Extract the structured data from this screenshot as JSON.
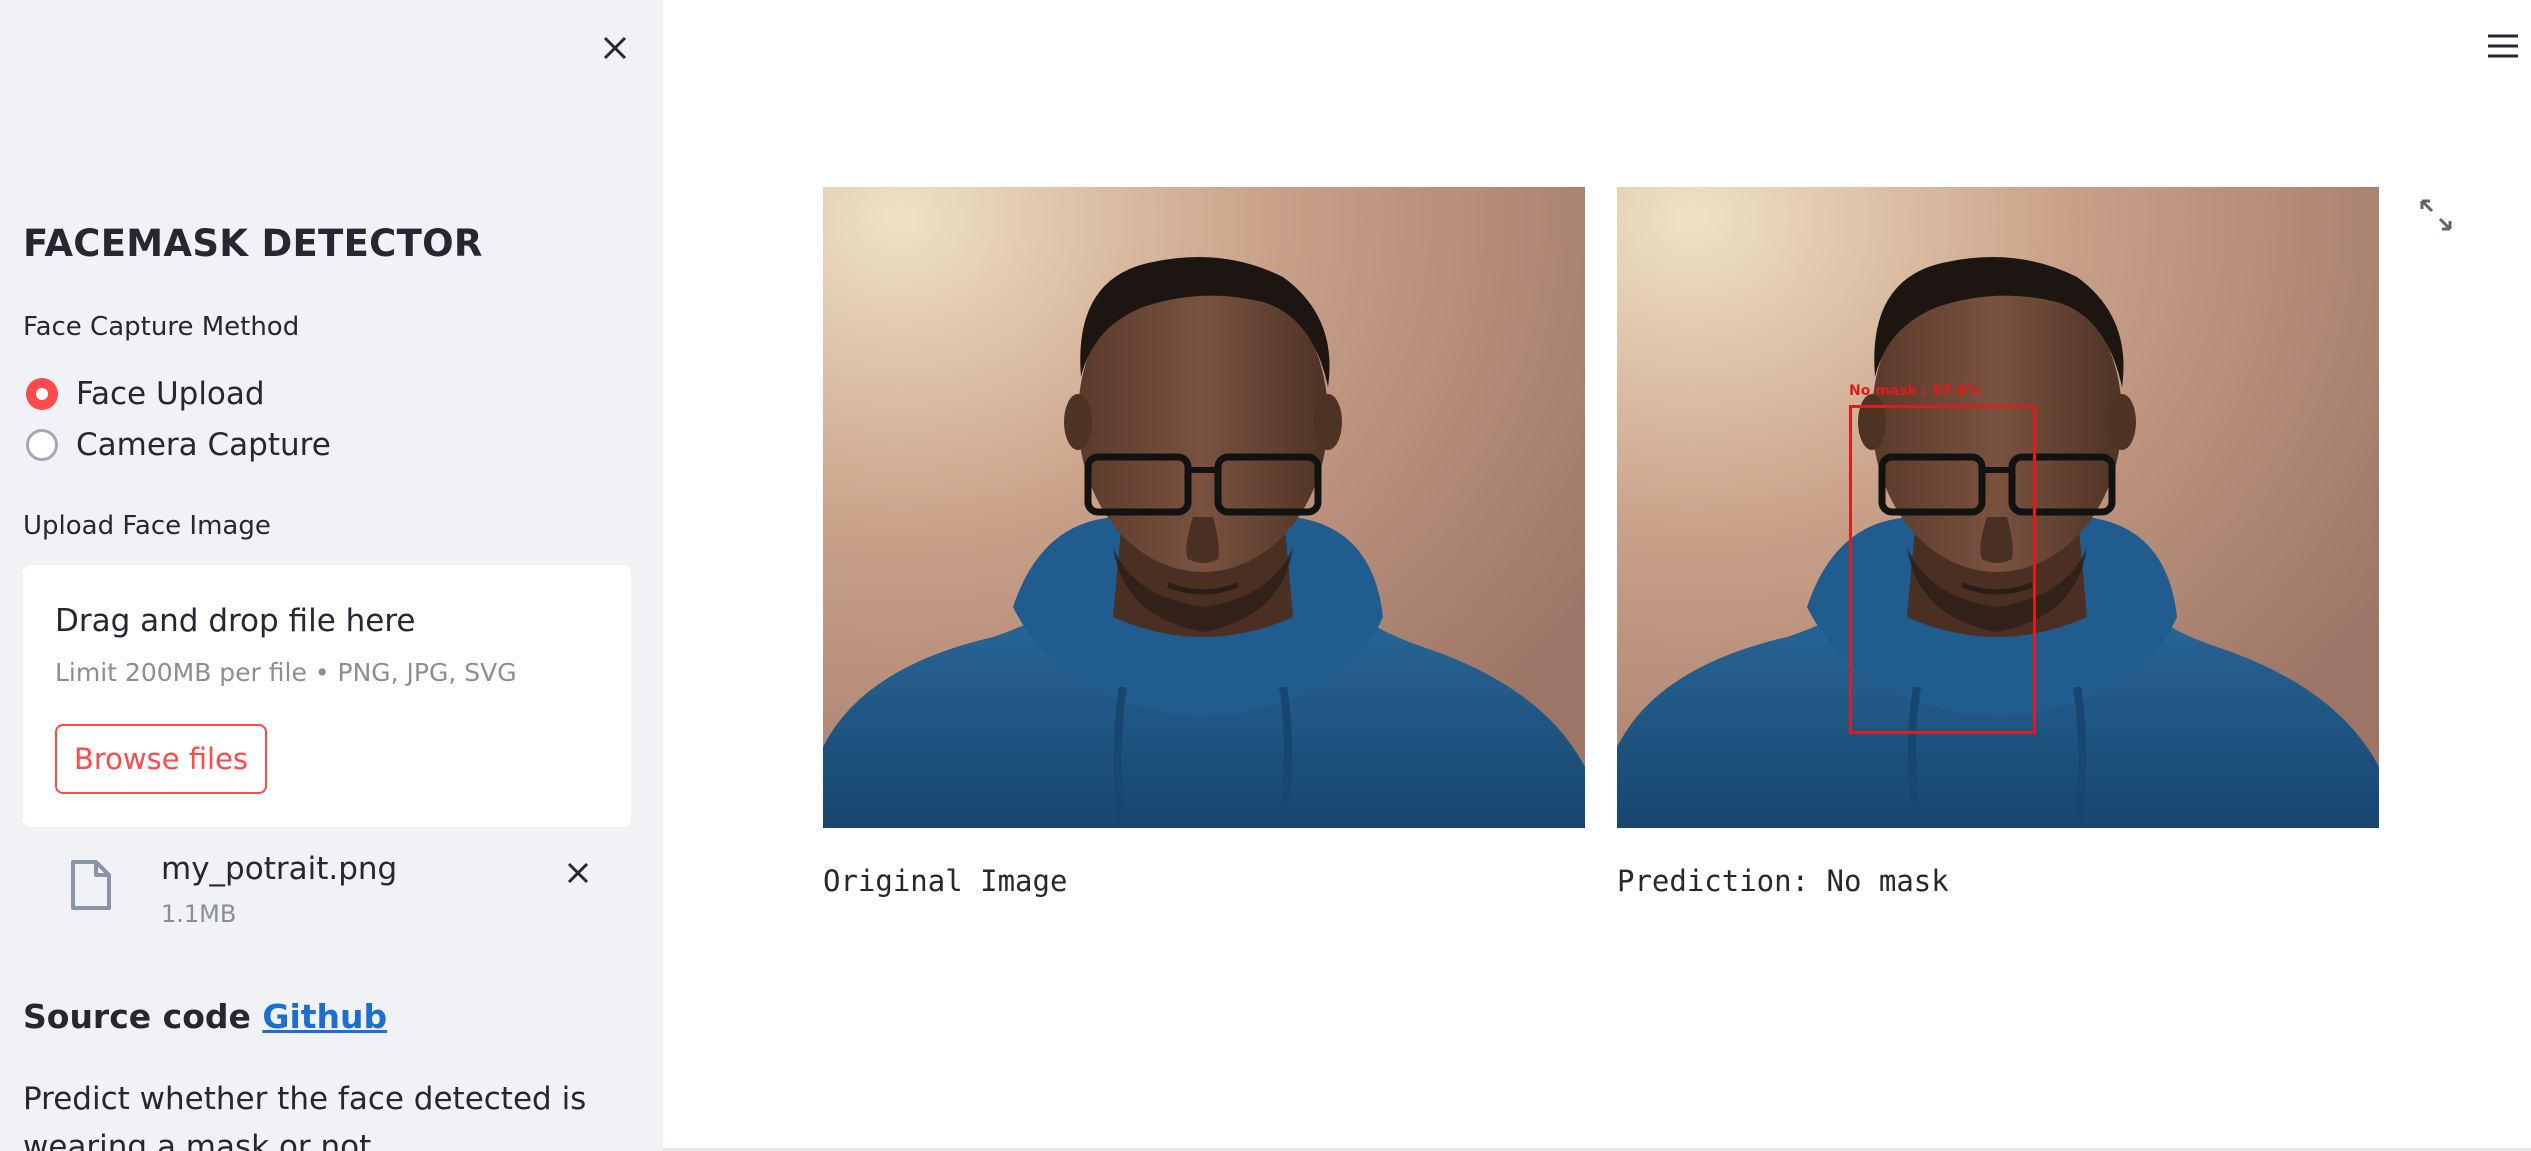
{
  "sidebar": {
    "title": "FACEMASK DETECTOR",
    "capture_method_label": "Face Capture Method",
    "capture_options": [
      {
        "label": "Face Upload",
        "selected": true
      },
      {
        "label": "Camera Capture",
        "selected": false
      }
    ],
    "upload_label": "Upload Face Image",
    "dropzone": {
      "title": "Drag and drop file here",
      "limit": "Limit 200MB per file • PNG, JPG, SVG",
      "browse_label": "Browse files"
    },
    "uploaded_file": {
      "name": "my_potrait.png",
      "size": "1.1MB"
    },
    "source_prefix": "Source code",
    "source_link": "Github",
    "description": "Predict whether the face detected is wearing a mask or not"
  },
  "main": {
    "original_caption": "Original Image",
    "prediction_caption": "Prediction: No mask",
    "prediction_overlay": {
      "label": "No mask : 97.8%",
      "color": "#e01b1b"
    }
  },
  "colors": {
    "accent": "#ff4b4b",
    "link": "#1c6fd1",
    "sidebar_bg": "#f0f2f6"
  },
  "icons": {
    "sidebar_close": "close-icon",
    "menu": "hamburger-icon",
    "fullscreen": "expand-icon",
    "file": "file-icon",
    "file_remove": "close-icon"
  }
}
